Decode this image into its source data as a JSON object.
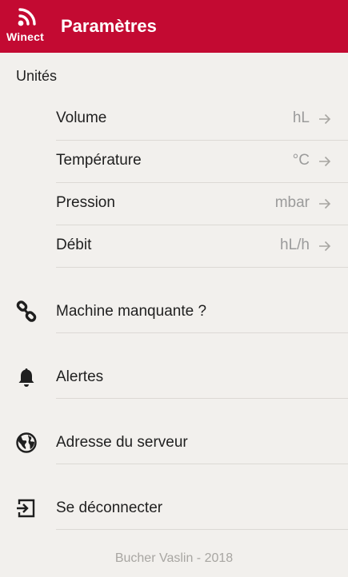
{
  "header": {
    "logo_text": "Winect",
    "title": "Paramètres",
    "bar_color": "#c30a32"
  },
  "units": {
    "section_label": "Unités",
    "items": [
      {
        "label": "Volume",
        "value": "hL"
      },
      {
        "label": "Température",
        "value": "°C"
      },
      {
        "label": "Pression",
        "value": "mbar"
      },
      {
        "label": "Débit",
        "value": "hL/h"
      }
    ]
  },
  "menu": {
    "items": [
      {
        "label": "Machine manquante ?",
        "icon": "link-icon"
      },
      {
        "label": "Alertes",
        "icon": "bell-icon"
      },
      {
        "label": "Adresse du serveur",
        "icon": "globe-icon"
      },
      {
        "label": "Se déconnecter",
        "icon": "logout-icon"
      }
    ]
  },
  "footer": {
    "text": "Bucher Vaslin - 2018"
  }
}
